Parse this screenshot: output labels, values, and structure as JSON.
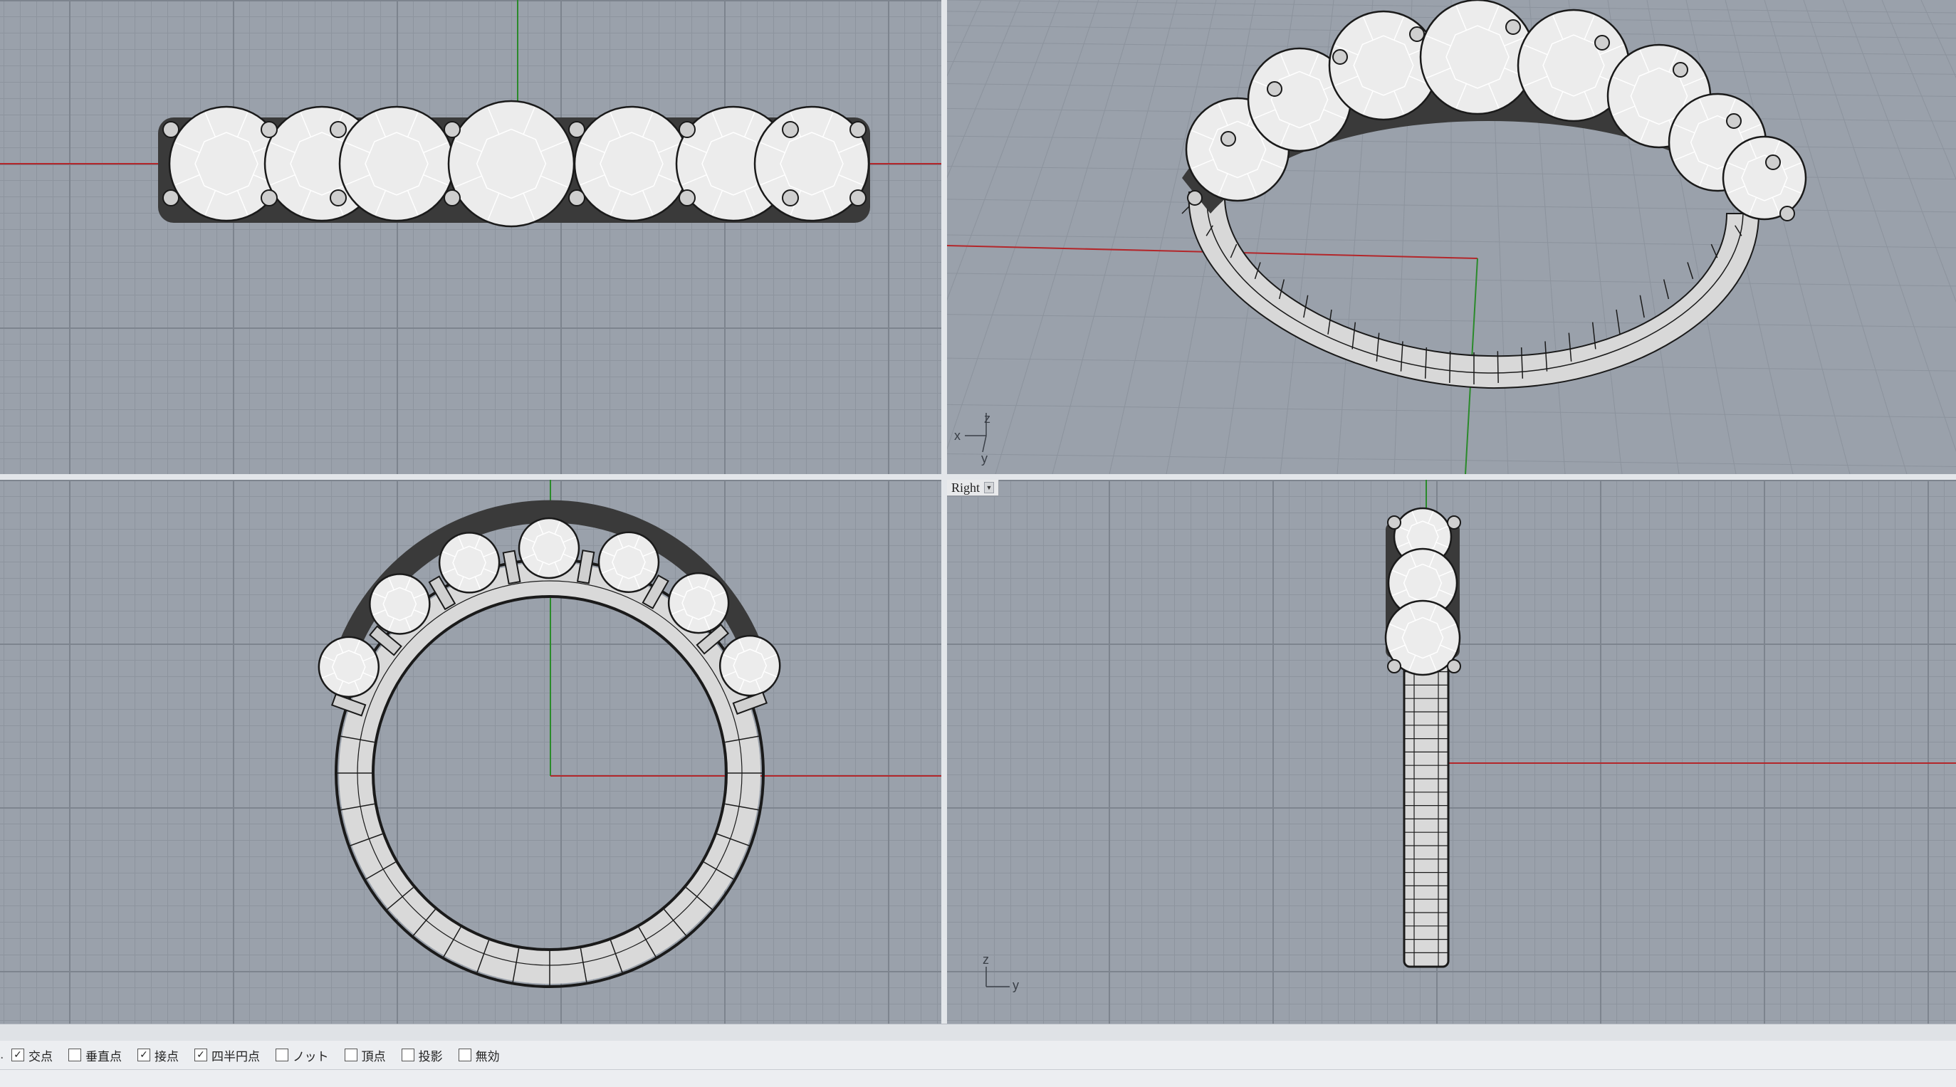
{
  "viewports": {
    "top": {},
    "perspective": {
      "axes": {
        "x": "x",
        "y": "y",
        "z": "z"
      }
    },
    "front": {},
    "right": {
      "title": "Right",
      "axes": {
        "y": "y",
        "z": "z"
      }
    }
  },
  "osnap": [
    {
      "label": "交点",
      "checked": true
    },
    {
      "label": "垂直点",
      "checked": false
    },
    {
      "label": "接点",
      "checked": true
    },
    {
      "label": "四半円点",
      "checked": true
    },
    {
      "label": "ノット",
      "checked": false
    },
    {
      "label": "頂点",
      "checked": false
    },
    {
      "label": "投影",
      "checked": false
    },
    {
      "label": "無効",
      "checked": false
    }
  ],
  "colors": {
    "viewport_bg": "#9aa1ab",
    "x_axis": "#b3262a",
    "y_axis": "#2a8a2a",
    "model_fill": "#d9d9d9",
    "gem_fill": "#ececec",
    "wire": "#1a1a1a"
  }
}
